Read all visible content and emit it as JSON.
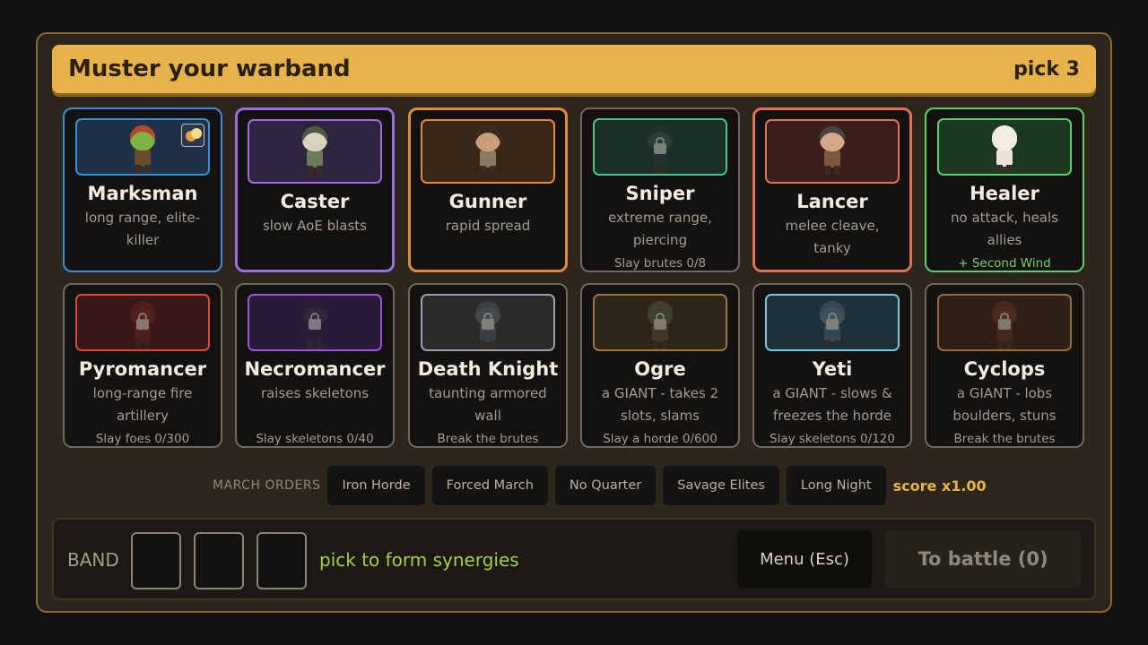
{
  "header": {
    "title": "Muster your warband",
    "pick": "pick 3"
  },
  "cards": [
    {
      "name": "Marksman",
      "desc": "long range, elite-killer",
      "sub": "",
      "perk": "",
      "accent": "#3d8fd6",
      "portrait_bg": "#1e3148",
      "portrait_border": "#3d8fd6",
      "skin": "#7cb342",
      "hair": "#b84626",
      "cloth": "#6a4a2c",
      "locked": false,
      "icon": "goblin-archer-icon",
      "corner": true
    },
    {
      "name": "Caster",
      "desc": "slow AoE blasts",
      "sub": "",
      "perk": "",
      "accent": "#9c6ee0",
      "portrait_bg": "#2e2440",
      "portrait_border": "#9c6ee0",
      "skin": "#d9d2c0",
      "hair": "#4a5a3a",
      "cloth": "#6b7a5a",
      "locked": false,
      "icon": "skeleton-mage-icon",
      "corner": false
    },
    {
      "name": "Gunner",
      "desc": "rapid spread",
      "sub": "",
      "perk": "",
      "accent": "#e08a3a",
      "portrait_bg": "#3a2616",
      "portrait_border": "#e08a3a",
      "skin": "#c99e78",
      "hair": "#3a2a20",
      "cloth": "#8a7a62",
      "locked": false,
      "icon": "gunner-icon",
      "corner": false
    },
    {
      "name": "Sniper",
      "desc": "extreme range, piercing",
      "sub": "Slay brutes  0/8",
      "perk": "",
      "accent": "#6e6a62",
      "portrait_bg": "#1a3028",
      "portrait_border": "#4fbf8a",
      "skin": "#3a4a4a",
      "hair": "#2a3434",
      "cloth": "#2a3434",
      "locked": true,
      "icon": "sniper-icon",
      "corner": false
    },
    {
      "name": "Lancer",
      "desc": "melee cleave, tanky",
      "sub": "",
      "perk": "",
      "accent": "#e0705a",
      "portrait_bg": "#3a1e1a",
      "portrait_border": "#e0705a",
      "skin": "#d4a888",
      "hair": "#4a4240",
      "cloth": "#7a5a3a",
      "locked": false,
      "icon": "lancer-icon",
      "corner": false
    },
    {
      "name": "Healer",
      "desc": "no attack, heals allies",
      "sub": "",
      "perk": "+ Second Wind",
      "accent": "#5ccf6e",
      "portrait_bg": "#1c3a20",
      "portrait_border": "#5ccf6e",
      "skin": "#f2ece4",
      "hair": "#f2ece4",
      "cloth": "#e8e2da",
      "locked": false,
      "icon": "healer-icon",
      "corner": false
    },
    {
      "name": "Pyromancer",
      "desc": "long-range fire artillery",
      "sub": "Slay foes  0/300",
      "perk": "",
      "accent": "#6e6a62",
      "portrait_bg": "#3a1616",
      "portrait_border": "#d94a3a",
      "skin": "#6a2a22",
      "hair": "#5a2a22",
      "cloth": "#5a2a22",
      "locked": true,
      "icon": "pyromancer-icon",
      "corner": false
    },
    {
      "name": "Necromancer",
      "desc": "raises skeletons",
      "sub": "Slay skeletons  0/40",
      "perk": "",
      "accent": "#6e6a62",
      "portrait_bg": "#2a1a3a",
      "portrait_border": "#9a56d6",
      "skin": "#3a3040",
      "hair": "#2a2232",
      "cloth": "#2a2232",
      "locked": true,
      "icon": "necromancer-icon",
      "corner": false
    },
    {
      "name": "Death Knight",
      "desc": "taunting armored wall",
      "sub": "Break the brutes",
      "perk": "",
      "accent": "#6e6a62",
      "portrait_bg": "#2a2a2a",
      "portrait_border": "#9aa0a8",
      "skin": "#5a6068",
      "hair": "#4a5058",
      "cloth": "#4a5058",
      "locked": true,
      "icon": "death-knight-icon",
      "corner": false
    },
    {
      "name": "Ogre",
      "desc": "a GIANT - takes 2 slots, slams",
      "sub": "Slay a horde  0/600",
      "perk": "",
      "accent": "#6e6a62",
      "portrait_bg": "#2e2518",
      "portrait_border": "#9a7440",
      "skin": "#4a5a3a",
      "hair": "#5a5048",
      "cloth": "#5a4a38",
      "locked": true,
      "icon": "ogre-icon",
      "corner": false
    },
    {
      "name": "Yeti",
      "desc": "a GIANT - slows & freezes the horde",
      "sub": "Slay skeletons  0/120",
      "perk": "",
      "accent": "#6e6a62",
      "portrait_bg": "#1e3038",
      "portrait_border": "#7ac6d8",
      "skin": "#5a6e78",
      "hair": "#4a5e68",
      "cloth": "#4a5e68",
      "locked": true,
      "icon": "yeti-icon",
      "corner": false
    },
    {
      "name": "Cyclops",
      "desc": "a GIANT - lobs boulders, stuns",
      "sub": "Break the brutes",
      "perk": "",
      "accent": "#6e6a62",
      "portrait_bg": "#2e2016",
      "portrait_border": "#9a6a3a",
      "skin": "#6a3a2a",
      "hair": "#5a3228",
      "cloth": "#5a3228",
      "locked": true,
      "icon": "cyclops-icon",
      "corner": false
    }
  ],
  "orders": {
    "label": "MARCH ORDERS",
    "buttons": [
      "Iron Horde",
      "Forced March",
      "No Quarter",
      "Savage Elites",
      "Long Night"
    ],
    "score": "score x1.00"
  },
  "band": {
    "label": "BAND",
    "hint": "pick to form synergies",
    "menu": "Menu  (Esc)",
    "battle": "To battle (0)"
  }
}
